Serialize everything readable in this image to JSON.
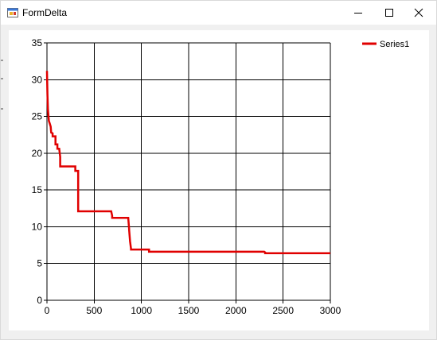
{
  "window": {
    "title": "FormDelta",
    "icons": {
      "app": "winforms-app-icon",
      "minimize": "minimize-icon",
      "maximize": "maximize-icon",
      "close": "close-icon"
    }
  },
  "chart_data": {
    "type": "line",
    "title": "",
    "xlabel": "",
    "ylabel": "",
    "xlim": [
      0,
      3000
    ],
    "ylim": [
      0,
      35
    ],
    "x_ticks": [
      "0",
      "500",
      "1000",
      "1500",
      "2000",
      "2500",
      "3000"
    ],
    "y_ticks": [
      "0",
      "5",
      "10",
      "15",
      "20",
      "25",
      "30",
      "35"
    ],
    "x_tick_values": [
      0,
      500,
      1000,
      1500,
      2000,
      2500,
      3000
    ],
    "y_tick_values": [
      0,
      5,
      10,
      15,
      20,
      25,
      30,
      35
    ],
    "grid": true,
    "legend_position": "top-right",
    "series": [
      {
        "name": "Series1",
        "color": "#e00000",
        "x": [
          0,
          5,
          10,
          15,
          20,
          30,
          40,
          45,
          60,
          60,
          90,
          90,
          110,
          110,
          130,
          140,
          140,
          300,
          300,
          330,
          330,
          340,
          680,
          690,
          690,
          860,
          870,
          870,
          880,
          890,
          890,
          1080,
          1080,
          2300,
          2310,
          2310,
          3000
        ],
        "y": [
          31.2,
          28.0,
          26.0,
          25.2,
          24.4,
          24.0,
          23.6,
          22.8,
          22.7,
          22.3,
          22.3,
          21.2,
          21.2,
          20.6,
          20.6,
          19.5,
          18.2,
          18.2,
          17.6,
          17.6,
          12.1,
          12.1,
          12.1,
          11.5,
          11.2,
          11.2,
          9.7,
          9.6,
          8.0,
          7.0,
          6.9,
          6.9,
          6.6,
          6.6,
          6.5,
          6.4,
          6.4
        ]
      }
    ]
  }
}
